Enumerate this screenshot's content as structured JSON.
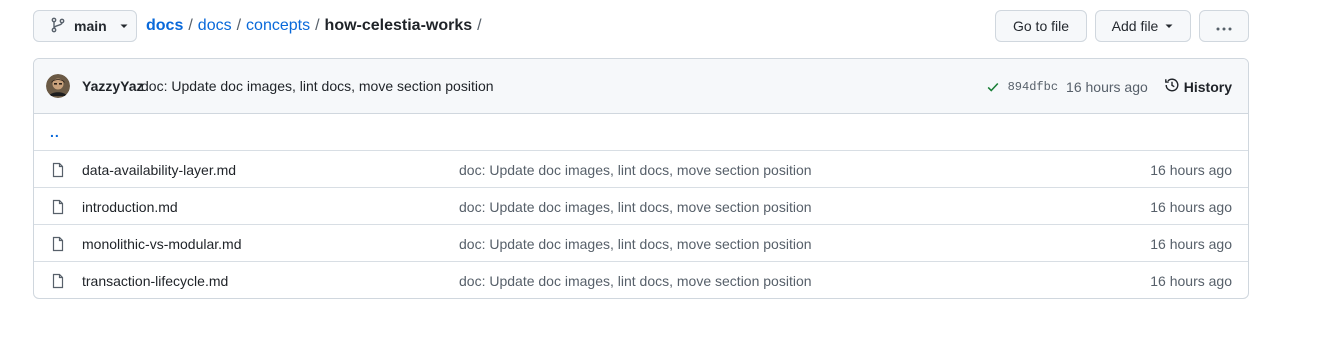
{
  "branch": {
    "icon": "git-branch-icon",
    "name": "main"
  },
  "breadcrumb": {
    "root": "docs",
    "parts": [
      "docs",
      "concepts"
    ],
    "current": "how-celestia-works",
    "separator": "/"
  },
  "toolbar": {
    "go_to_file": "Go to file",
    "add_file": "Add file",
    "more": "···"
  },
  "commit": {
    "author": "YazzyYaz",
    "message": "doc: Update doc images, lint docs, move section position",
    "sha": "894dfbc",
    "time": "16 hours ago",
    "history_label": "History",
    "status_color": "#1a7f37"
  },
  "parent_dir": "..",
  "files": [
    {
      "name": "data-availability-layer.md",
      "message": "doc: Update doc images, lint docs, move section position",
      "age": "16 hours ago"
    },
    {
      "name": "introduction.md",
      "message": "doc: Update doc images, lint docs, move section position",
      "age": "16 hours ago"
    },
    {
      "name": "monolithic-vs-modular.md",
      "message": "doc: Update doc images, lint docs, move section position",
      "age": "16 hours ago"
    },
    {
      "name": "transaction-lifecycle.md",
      "message": "doc: Update doc images, lint docs, move section position",
      "age": "16 hours ago"
    }
  ],
  "colors": {
    "link": "#0969da",
    "muted": "#57606a",
    "border": "#d0d7de",
    "success": "#1a7f37"
  }
}
